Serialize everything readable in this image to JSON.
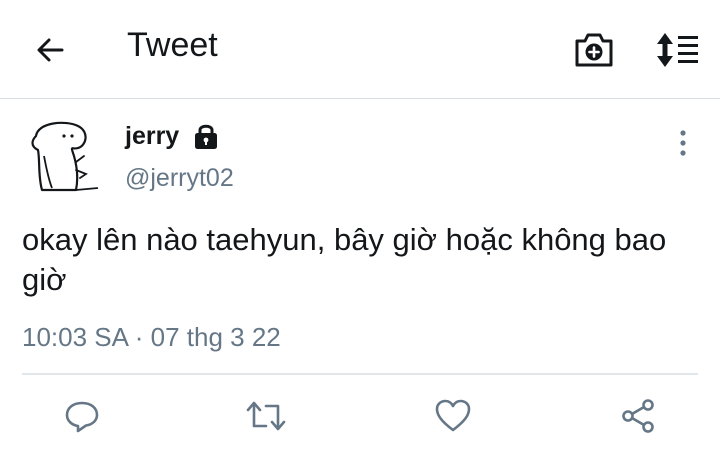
{
  "header": {
    "title": "Tweet",
    "icons": [
      "back-arrow-icon",
      "camera-add-icon",
      "sort-toggle-icon"
    ]
  },
  "tweet": {
    "author_name": "jerry",
    "author_handle": "@jerryt02",
    "protected": true,
    "text": "okay lên nào taehyun, bây giờ hoặc không bao giờ",
    "timestamp": "10:03 SA · 07 thg 3 22"
  },
  "actions": [
    "reply-icon",
    "retweet-icon",
    "like-icon",
    "share-icon"
  ],
  "colors": {
    "primary_text": "#14171a",
    "secondary_text": "#657786",
    "divider": "#e1e6ea"
  }
}
